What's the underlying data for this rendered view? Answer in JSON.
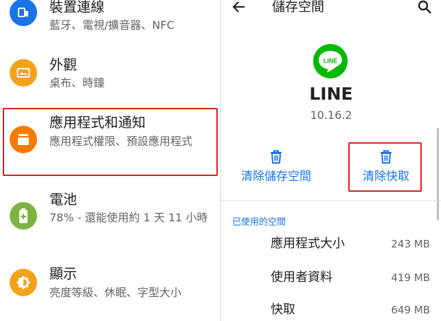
{
  "settings": {
    "items": [
      {
        "title": "裝置連線",
        "subtitle": "藍牙、電視/擴音器、NFC",
        "icon": "device-connection-icon",
        "color": "#1a73e8"
      },
      {
        "title": "外觀",
        "subtitle": "桌布、時鐘",
        "icon": "wallpaper-icon",
        "color": "#f4a21c"
      },
      {
        "title": "應用程式和通知",
        "subtitle": "應用程式權限、預設應用程式",
        "icon": "apps-icon",
        "color": "#f57c00"
      },
      {
        "title": "電池",
        "subtitle": "78% - 還能使用約 1 天 11 小時",
        "icon": "battery-icon",
        "color": "#7cb342"
      },
      {
        "title": "顯示",
        "subtitle": "亮度等級、休眠、字型大小",
        "icon": "display-brightness-icon",
        "color": "#f4a21c"
      }
    ]
  },
  "storage": {
    "title": "儲存空間",
    "app_logo_text": "LINE",
    "app_name": "LINE",
    "app_version": "10.16.2",
    "clear_storage_label": "清除儲存空間",
    "clear_cache_label": "清除快取",
    "section_header": "已使用的空間",
    "usage": [
      {
        "label": "應用程式大小",
        "value": "243 MB"
      },
      {
        "label": "使用者資料",
        "value": "419 MB"
      },
      {
        "label": "快取",
        "value": "649 MB"
      }
    ]
  },
  "colors": {
    "accent": "#1a73e8",
    "highlight": "#d21f1f",
    "line_green": "#00b900"
  }
}
